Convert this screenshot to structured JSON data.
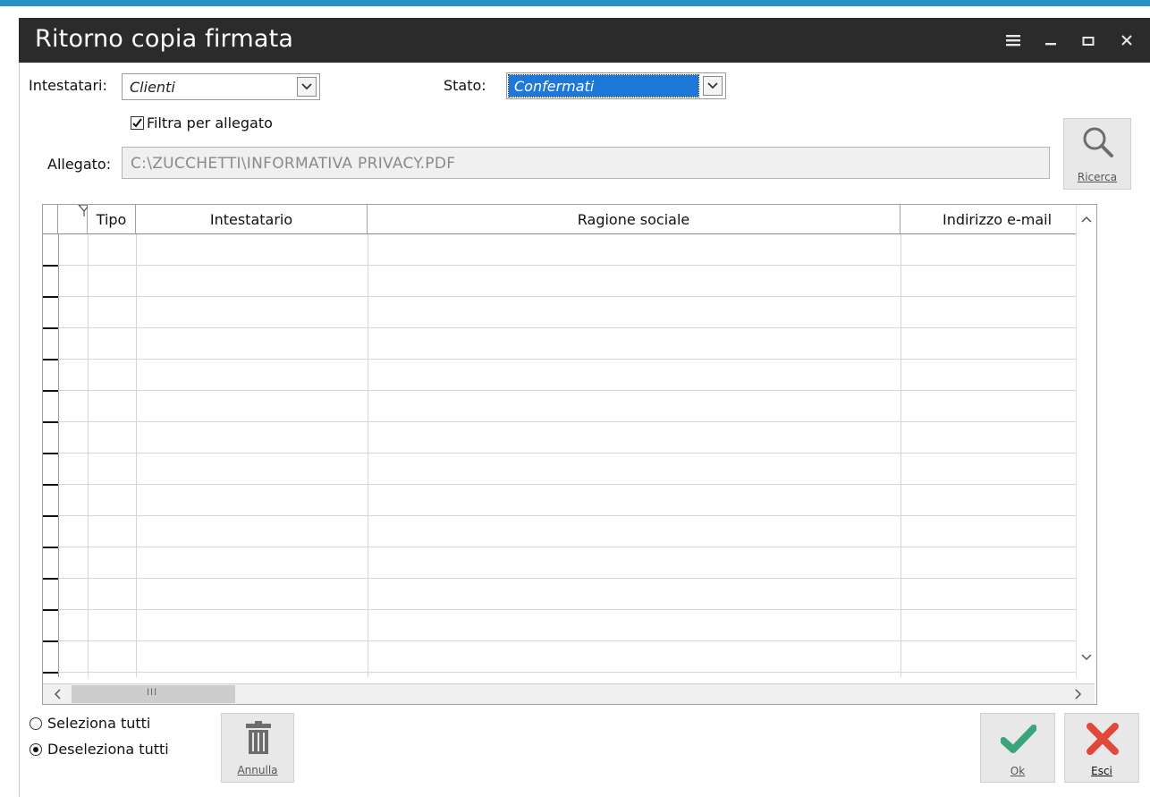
{
  "window": {
    "title": "Ritorno copia firmata",
    "accent_color": "#2c8fc8",
    "titlebar_color": "#2b2b2b"
  },
  "filters": {
    "intestatari_label": "Intestatari:",
    "intestatari_value": "Clienti",
    "stato_label": "Stato:",
    "stato_value": "Confermati",
    "filtra_label": "Filtra per allegato",
    "filtra_checked": true,
    "allegato_label": "Allegato:",
    "allegato_value": "C:\\ZUCCHETTI\\INFORMATIVA PRIVACY.PDF"
  },
  "ricerca_button": {
    "label": "Ricerca",
    "icon": "search-icon"
  },
  "grid": {
    "columns": [
      "Tipo",
      "Intestatario",
      "Ragione sociale",
      "Indirizzo e-mail"
    ],
    "rows": [],
    "hscroll_thumb_glyph": "III"
  },
  "selection": {
    "options": [
      "Seleziona tutti",
      "Deseleziona tutti"
    ],
    "selected": "Deseleziona tutti"
  },
  "buttons": {
    "annulla": {
      "label": "Annulla",
      "icon": "trash-icon"
    },
    "ok": {
      "label": "Ok",
      "icon": "check-icon",
      "color": "#3aa57a"
    },
    "esci": {
      "label": "Esci",
      "icon": "close-x-icon",
      "color": "#e0483a"
    }
  }
}
